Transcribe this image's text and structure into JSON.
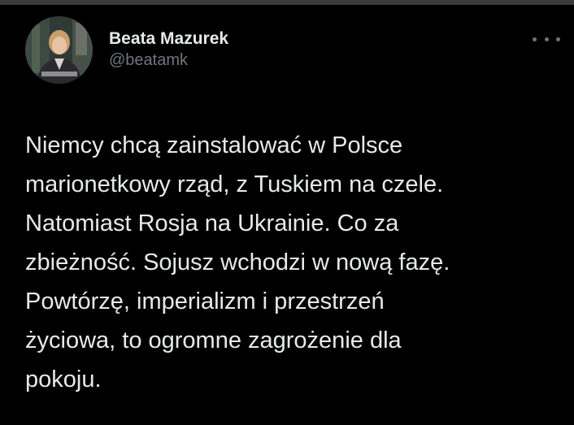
{
  "tweet": {
    "author": {
      "display_name": "Beata Mazurek",
      "handle": "@beatamk",
      "avatar_icon": "profile-photo"
    },
    "more_icon": "more-options-icon",
    "text_lines": [
      "Niemcy chcą zainstalować w Polsce",
      "marionetkowy rząd, z Tuskiem na czele.",
      "Natomiast Rosja na Ukrainie. Co za",
      "zbieżność. Sojusz wchodzi w nową fazę.",
      "Powtórzę, imperializm i przestrzeń",
      "życiowa, to ogromne zagrożenie dla",
      "pokoju."
    ]
  },
  "colors": {
    "background": "#000000",
    "text": "#e7e9ea",
    "secondary_text": "#71767b"
  }
}
